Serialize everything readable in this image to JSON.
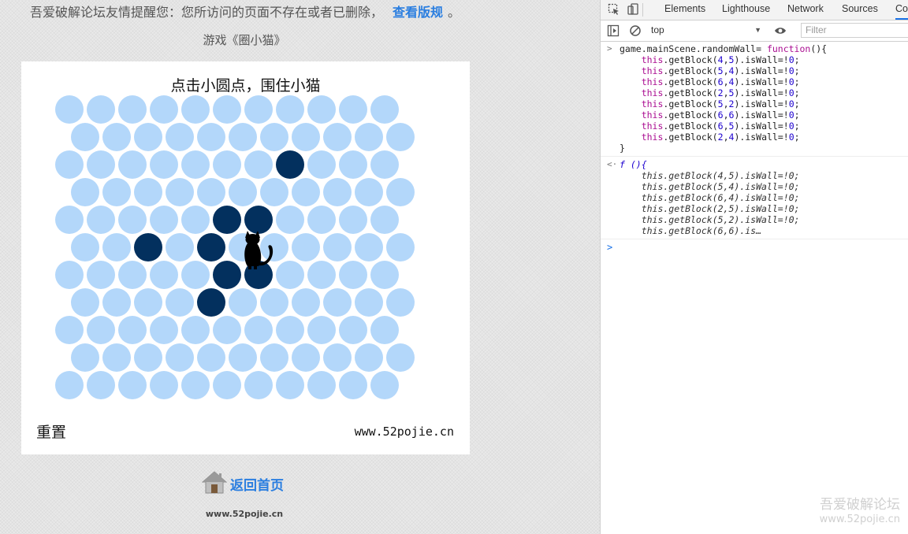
{
  "page": {
    "notice_text": "吾爱破解论坛友情提醒您：您所访问的页面不存在或者已删除，",
    "notice_link": "查看版规",
    "notice_tail": "。",
    "game_title": "游戏《圈小猫》",
    "board_heading": "点击小圆点，围住小猫",
    "reset_label": "重置",
    "board_site": "www.52pojie.cn",
    "home_label": "返回首页",
    "footer_site": "www.52pojie.cn"
  },
  "board": {
    "rows": 11,
    "cols": 11,
    "light_color": "#b3d7fa",
    "wall_color": "#03305e",
    "walls": [
      [
        5,
        2
      ],
      [
        2,
        7
      ],
      [
        4,
        5
      ],
      [
        5,
        4
      ],
      [
        4,
        6
      ],
      [
        7,
        4
      ],
      [
        6,
        5
      ],
      [
        6,
        6
      ]
    ],
    "cat_cell": [
      5,
      5
    ]
  },
  "devtools": {
    "tabs": [
      "Elements",
      "Lighthouse",
      "Network",
      "Sources",
      "Co"
    ],
    "active_tab": "Co",
    "context": "top",
    "filter_placeholder": "Filter",
    "input_lines": [
      "game.mainScene.randomWall= function(){",
      "this.getBlock(4,5).isWall=!0;",
      "this.getBlock(5,4).isWall=!0;",
      "this.getBlock(6,4).isWall=!0;",
      "this.getBlock(2,5).isWall=!0;",
      "this.getBlock(5,2).isWall=!0;",
      "this.getBlock(6,6).isWall=!0;",
      "this.getBlock(6,5).isWall=!0;",
      "this.getBlock(2,4).isWall=!0;",
      "}"
    ],
    "output_lines": [
      "f (){",
      "this.getBlock(4,5).isWall=!0;",
      "this.getBlock(5,4).isWall=!0;",
      "this.getBlock(6,4).isWall=!0;",
      "this.getBlock(2,5).isWall=!0;",
      "this.getBlock(5,2).isWall=!0;",
      "this.getBlock(6,6).is…"
    ]
  },
  "watermark": {
    "line1": "吾爱破解论坛",
    "line2": "www.52pojie.cn"
  }
}
